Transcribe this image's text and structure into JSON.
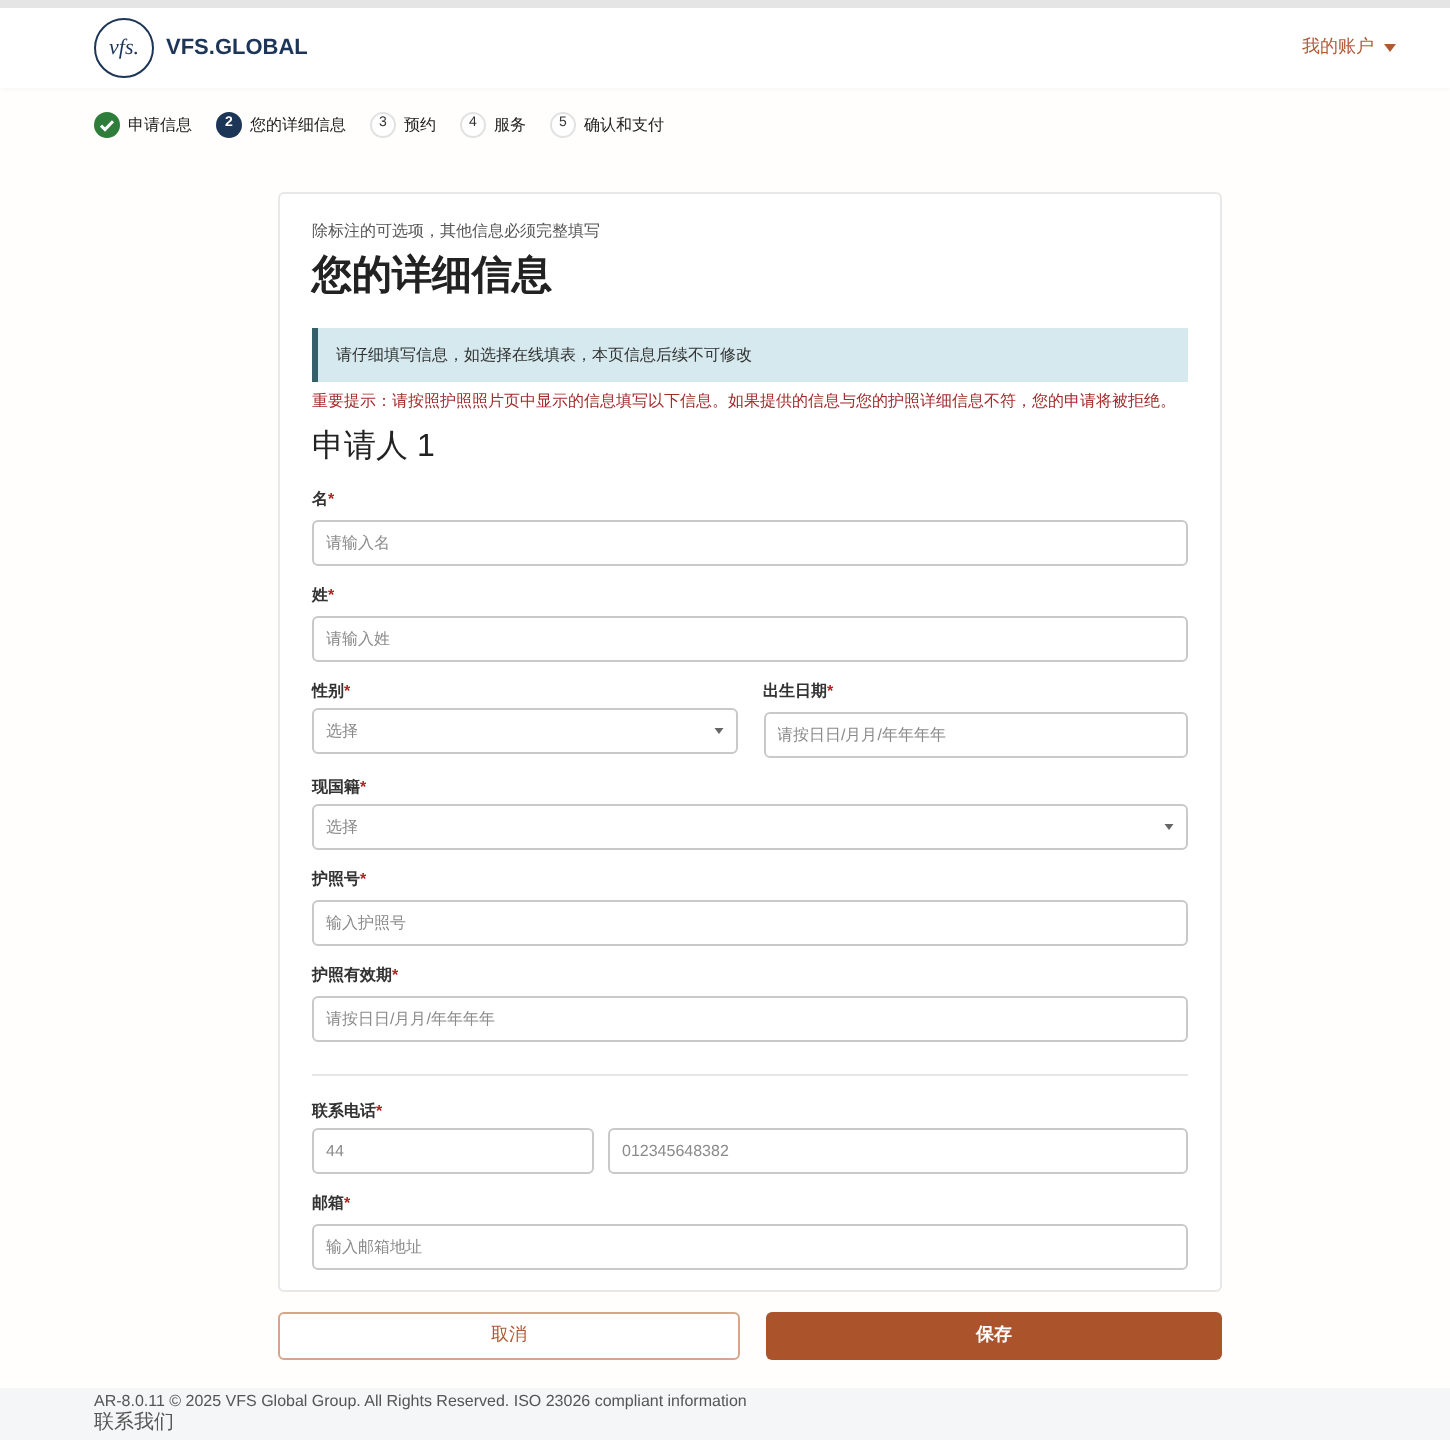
{
  "header": {
    "logo_mark": "vfs.",
    "logo_text": "VFS.GLOBAL",
    "account_menu": "我的账户"
  },
  "steps": [
    {
      "completed": true,
      "selected": false,
      "label": "申请信息"
    },
    {
      "completed": false,
      "selected": true,
      "number": "2",
      "label": "您的详细信息"
    },
    {
      "completed": false,
      "selected": false,
      "number": "3",
      "label": "预约"
    },
    {
      "completed": false,
      "selected": false,
      "number": "4",
      "label": "服务"
    },
    {
      "completed": false,
      "selected": false,
      "number": "5",
      "label": "确认和支付"
    }
  ],
  "form": {
    "hint": "除标注的可选项，其他信息必须完整填写",
    "title": "您的详细信息",
    "info_note": "请仔细填写信息，如选择在线填表，本页信息后续不可修改",
    "warning": "重要提示：请按照护照照片页中显示的信息填写以下信息。如果提供的信息与您的护照详细信息不符，您的申请将被拒绝。",
    "applicant_heading": "申请人 1",
    "sections": [
      {
        "rows": [
          [
            {
              "kind": "text",
              "label": "名",
              "mark": "*",
              "placeholder": "请输入名"
            }
          ],
          [
            {
              "kind": "text",
              "label": "姓",
              "mark": "*",
              "placeholder": "请输入姓"
            }
          ],
          [
            {
              "kind": "select",
              "label": "性别",
              "mark": "*",
              "placeholder": "选择"
            },
            {
              "kind": "text",
              "label": "出生日期",
              "mark": "*",
              "placeholder": "请按日日/月月/年年年年"
            }
          ],
          [
            {
              "kind": "select",
              "label": "现国籍",
              "mark": "*",
              "placeholder": "选择"
            }
          ],
          [
            {
              "kind": "text",
              "label": "护照号",
              "mark": "*",
              "placeholder": "输入护照号"
            }
          ],
          [
            {
              "kind": "text",
              "label": "护照有效期",
              "mark": "*",
              "placeholder": "请按日日/月月/年年年年"
            }
          ]
        ]
      },
      {
        "rows": [
          [
            {
              "kind": "phone",
              "label": "联系电话",
              "mark": "*",
              "code_placeholder": "44",
              "placeholder": "012345648382"
            }
          ],
          [
            {
              "kind": "text",
              "label": "邮箱",
              "mark": "*",
              "placeholder": "输入邮箱地址"
            }
          ]
        ]
      }
    ]
  },
  "buttons": {
    "cancel": "取消",
    "save": "保存"
  },
  "footer": {
    "copyright": "AR-8.0.11 © 2025 VFS Global Group. All Rights Reserved. ISO 23026 compliant information",
    "contact_link": "联系我们"
  }
}
